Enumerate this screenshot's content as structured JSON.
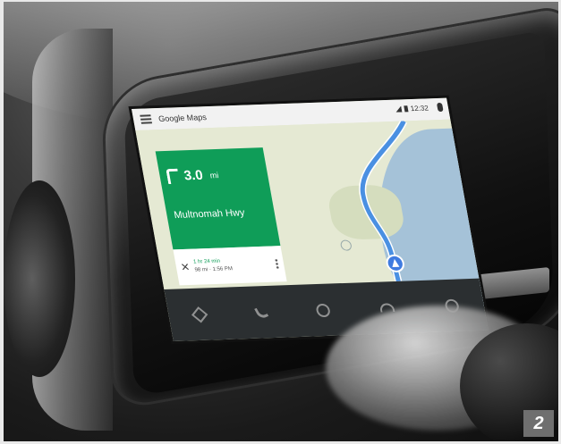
{
  "app": {
    "title": "Google Maps"
  },
  "status": {
    "time": "12:32"
  },
  "direction": {
    "distance": "3.0",
    "unit": "mi",
    "street": "Multnomah Hwy"
  },
  "eta": {
    "line1": "1 hr 24 min",
    "line2": "98 mi · 1:56 PM"
  },
  "caption": {
    "number": "2"
  },
  "colors": {
    "nav_green": "#0f9d58",
    "water": "#a5c2d8",
    "navbar": "#2b2f31"
  }
}
